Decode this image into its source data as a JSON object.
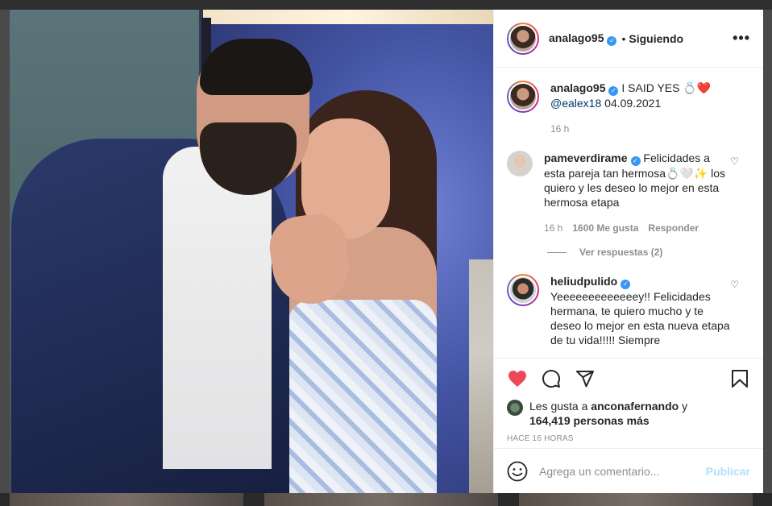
{
  "post": {
    "author": "analago95",
    "follow_state": "Siguiendo",
    "caption_text": "I SAID YES 💍❤️",
    "caption_mention": "@ealex18",
    "caption_date": "04.09.2021",
    "caption_age": "16 h"
  },
  "comments": [
    {
      "user": "pameverdirame",
      "text": "Felicidades a esta pareja tan hermosa💍🤍✨ los quiero y les deseo lo mejor en esta hermosa etapa",
      "age": "16 h",
      "likes": "1600 Me gusta",
      "reply": "Responder",
      "replies": "Ver respuestas (2)"
    },
    {
      "user": "heliudpulido",
      "text": "Yeeeeeeeeeeeeey!! Felicidades hermana, te quiero mucho y te deseo lo mejor en esta nueva etapa de tu vida!!!!! Siempre"
    }
  ],
  "likes": {
    "prefix": "Les gusta a",
    "user": "anconafernando",
    "connector": "y",
    "count": "164,419 personas más"
  },
  "timestamp": "HACE 16 HORAS",
  "composer": {
    "placeholder": "Agrega un comentario...",
    "publish": "Publicar"
  },
  "colors": {
    "liked_heart": "#ed4956",
    "verified": "#3897f0",
    "publish_disabled": "#b2dffc"
  },
  "icons": [
    "more-icon",
    "verified-icon",
    "heart-icon",
    "comment-icon",
    "share-icon",
    "save-icon",
    "emoji-icon"
  ]
}
